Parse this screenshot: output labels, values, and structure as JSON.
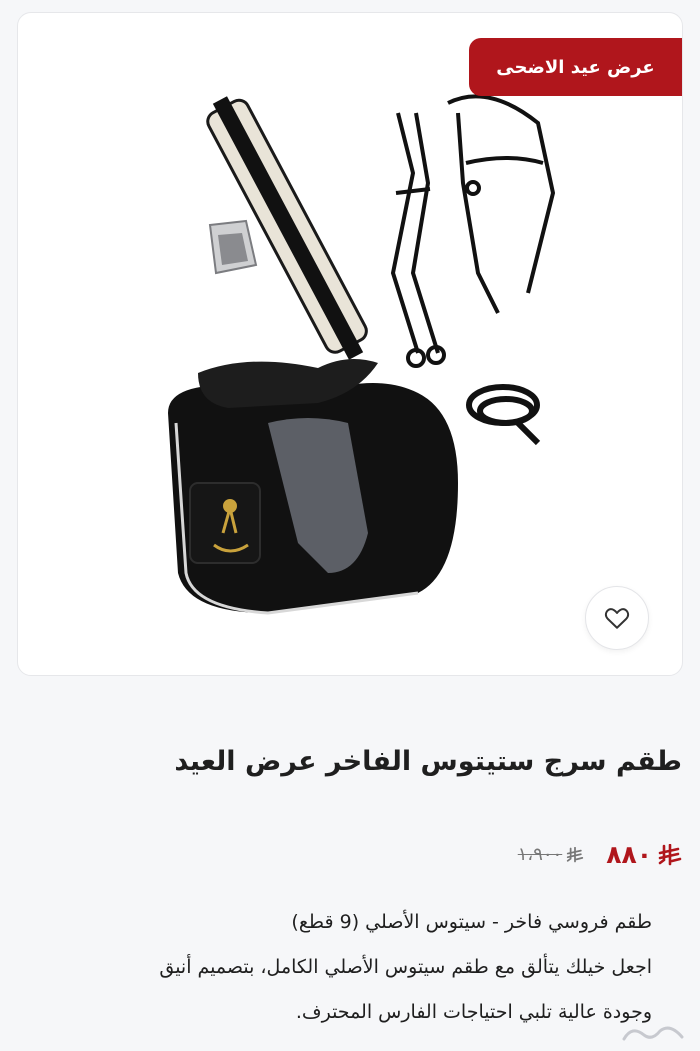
{
  "promo_badge": "عرض عيد الاضحى",
  "product": {
    "title": "طقم سرج ستيتوس الفاخر عرض العيد",
    "price_current": "٨٨٠",
    "price_old": "١،٩٠٠",
    "currency_icon": "riyal-icon",
    "description": [
      "طقم فروسي فاخر - سيتوس الأصلي (9 قطع)",
      "اجعل خيلك يتألق مع طقم سيتوس الأصلي الكامل، بتصميم أنيق",
      "وجودة عالية تلبي احتياجات الفارس المحترف."
    ]
  },
  "colors": {
    "accent": "#b0161c",
    "text": "#1f1f1f",
    "background": "#f6f7f9"
  },
  "icons": {
    "favorite": "heart-icon",
    "watermark": "haraj-watermark"
  }
}
